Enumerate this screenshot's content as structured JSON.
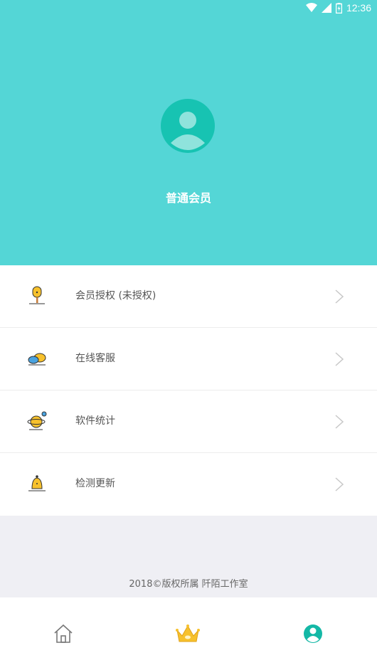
{
  "status_bar": {
    "time": "12:36"
  },
  "header": {
    "member_title": "普通会员",
    "bg_color": "#54d6d6"
  },
  "menu": {
    "items": [
      {
        "label": "会员授权 (未授权)",
        "icon": "popsicle-icon"
      },
      {
        "label": "在线客服",
        "icon": "chat-bubbles-icon"
      },
      {
        "label": "软件统计",
        "icon": "planet-icon"
      },
      {
        "label": "检测更新",
        "icon": "bell-icon"
      }
    ]
  },
  "footer": {
    "copyright": "2018©版权所属  阡陌工作室"
  },
  "tabbar": {
    "tabs": [
      {
        "name": "home",
        "icon": "home-icon"
      },
      {
        "name": "vip",
        "icon": "crown-icon"
      },
      {
        "name": "profile",
        "icon": "profile-icon",
        "active": true
      }
    ],
    "accent": "#14b8a6"
  }
}
